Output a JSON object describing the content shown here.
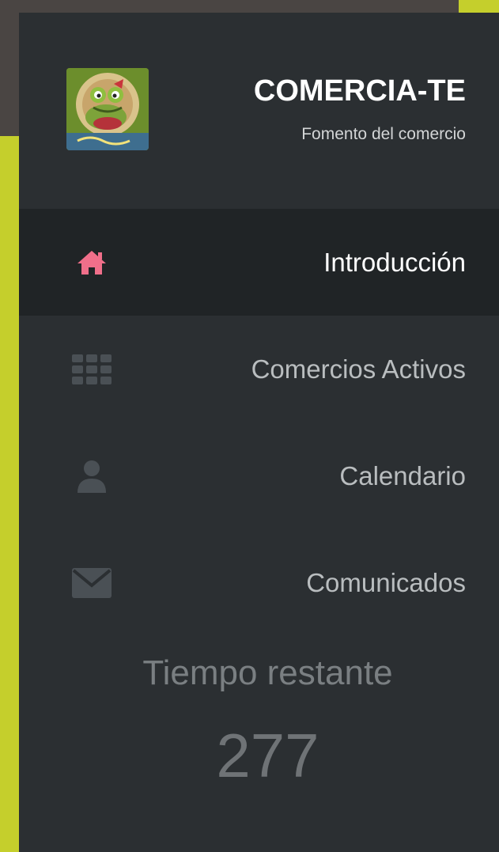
{
  "brand": {
    "title": "COMERCIA-TE",
    "subtitle": "Fomento del comercio",
    "logo_icon": "frog-mascot-logo"
  },
  "nav": {
    "items": [
      {
        "label": "Introducción",
        "icon": "home-icon",
        "active": true
      },
      {
        "label": "Comercios Activos",
        "icon": "grid-icon",
        "active": false
      },
      {
        "label": "Calendario",
        "icon": "user-icon",
        "active": false
      },
      {
        "label": "Comunicados",
        "icon": "envelope-icon",
        "active": false
      }
    ]
  },
  "timer": {
    "label": "Tiempo restante",
    "value": "277"
  },
  "colors": {
    "sidebar_bg": "#2b2f32",
    "active_bg": "#202426",
    "accent_pink": "#f06f8a",
    "muted_icon": "#4a5055",
    "lime": "#c5cf2c",
    "outer_dark": "#4a4543"
  }
}
